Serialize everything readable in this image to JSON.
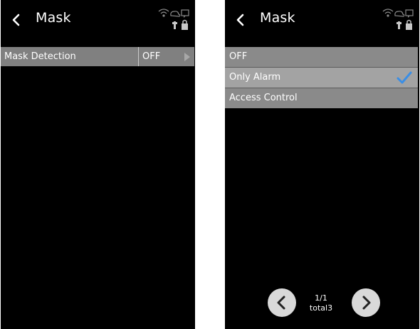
{
  "left_screen": {
    "title": "Mask",
    "rows": [
      {
        "label": "Mask Detection",
        "value": "OFF"
      }
    ]
  },
  "right_screen": {
    "title": "Mask",
    "options": [
      {
        "label": "OFF",
        "selected": false
      },
      {
        "label": "Only Alarm",
        "selected": true
      },
      {
        "label": "Access Control",
        "selected": false
      }
    ],
    "pager": {
      "page": "1/1",
      "total": "total3"
    }
  },
  "icons": [
    "back-arrow-icon",
    "wifi-icon",
    "cloud-icon",
    "chat-icon",
    "usb-icon",
    "lock-icon",
    "check-icon",
    "chevron-left-icon",
    "chevron-right-icon",
    "arrow-right-icon"
  ],
  "colors": {
    "background": "#000000",
    "row": "#808080",
    "selected_row": "#a3a3a3",
    "check": "#3a8ee6",
    "pager_button": "#d9d9d9"
  }
}
